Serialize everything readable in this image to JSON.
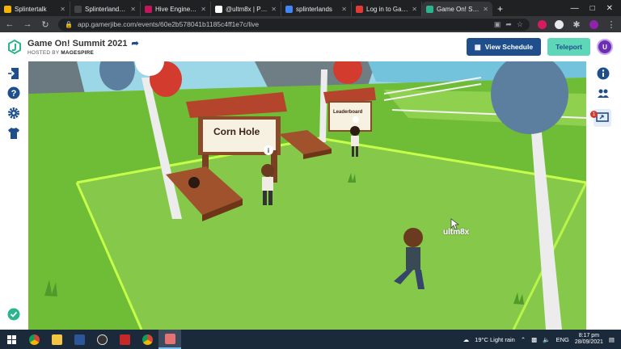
{
  "browser": {
    "tabs": [
      {
        "title": "Splintertalk",
        "color": "#f5b400"
      },
      {
        "title": "Splinterlands - C...",
        "color": "#444444"
      },
      {
        "title": "Hive Engine - Sm...",
        "color": "#c2185b"
      },
      {
        "title": "@ultm8x | PeakD",
        "color": "#ffffff"
      },
      {
        "title": "splinterlands",
        "color": "#4285f4"
      },
      {
        "title": "Log in to Gamerji...",
        "color": "#e53935"
      },
      {
        "title": "Game On! Su...",
        "color": "#2bb58f"
      }
    ],
    "active_tab_index": 6,
    "url": "app.gamerjibe.com/events/60e2b578041b1185c4ff1e7c/live"
  },
  "header": {
    "title": "Game On! Summit 2021",
    "hosted_prefix": "HOSTED BY",
    "host": "MAGESPIRE",
    "view_schedule_label": "View Schedule",
    "teleport_label": "Teleport",
    "avatar_letter": "U"
  },
  "right_sidebar": {
    "notification_count": "1"
  },
  "scene": {
    "corn_hole_sign": "Corn Hole",
    "leaderboard_sign": "Leaderboard",
    "player_name": "ultm8x"
  },
  "taskbar": {
    "weather": "19°C  Light rain",
    "language": "ENG",
    "time": "8:17 pm",
    "date": "28/09/2021"
  },
  "colors": {
    "brand_blue": "#1e4e8c",
    "teleport_teal": "#5ed6b8",
    "grass": "#7cc63f"
  }
}
